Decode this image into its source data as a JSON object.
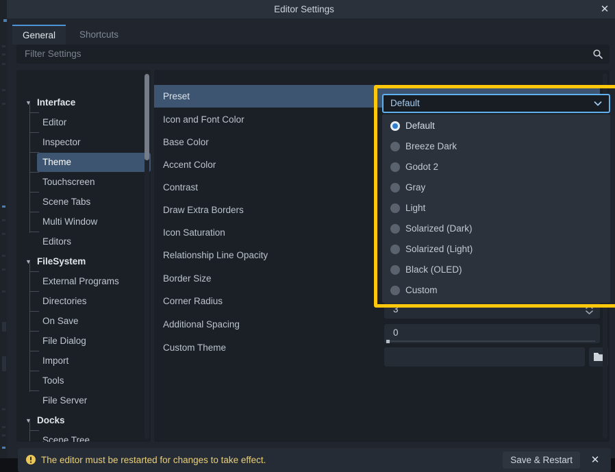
{
  "window": {
    "title": "Editor Settings",
    "close_icon": "close-icon"
  },
  "tabs": [
    {
      "label": "General",
      "active": true
    },
    {
      "label": "Shortcuts",
      "active": false
    }
  ],
  "filter": {
    "placeholder": "Filter Settings",
    "value": "",
    "icon": "search-icon"
  },
  "sidebar": {
    "items": [
      {
        "label": "Interface",
        "type": "category",
        "expanded": true,
        "selected": false
      },
      {
        "label": "Editor",
        "type": "child",
        "selected": false
      },
      {
        "label": "Inspector",
        "type": "child",
        "selected": false
      },
      {
        "label": "Theme",
        "type": "child",
        "selected": true
      },
      {
        "label": "Touchscreen",
        "type": "child",
        "selected": false
      },
      {
        "label": "Scene Tabs",
        "type": "child",
        "selected": false
      },
      {
        "label": "Multi Window",
        "type": "child",
        "selected": false
      },
      {
        "label": "Editors",
        "type": "child",
        "selected": false
      },
      {
        "label": "FileSystem",
        "type": "category",
        "expanded": true,
        "selected": false
      },
      {
        "label": "External Programs",
        "type": "child",
        "selected": false
      },
      {
        "label": "Directories",
        "type": "child",
        "selected": false
      },
      {
        "label": "On Save",
        "type": "child",
        "selected": false
      },
      {
        "label": "File Dialog",
        "type": "child",
        "selected": false
      },
      {
        "label": "Import",
        "type": "child",
        "selected": false
      },
      {
        "label": "Tools",
        "type": "child",
        "selected": false
      },
      {
        "label": "File Server",
        "type": "child",
        "selected": false
      },
      {
        "label": "Docks",
        "type": "category",
        "expanded": true,
        "selected": false
      },
      {
        "label": "Scene Tree",
        "type": "child",
        "selected": false
      }
    ]
  },
  "properties": [
    {
      "name": "Preset",
      "selected": true
    },
    {
      "name": "Icon and Font Color",
      "selected": false
    },
    {
      "name": "Base Color",
      "selected": false
    },
    {
      "name": "Accent Color",
      "selected": false
    },
    {
      "name": "Contrast",
      "selected": false
    },
    {
      "name": "Draw Extra Borders",
      "selected": false
    },
    {
      "name": "Icon Saturation",
      "selected": false
    },
    {
      "name": "Relationship Line Opacity",
      "selected": false
    },
    {
      "name": "Border Size",
      "selected": false
    },
    {
      "name": "Corner Radius",
      "selected": false
    },
    {
      "name": "Additional Spacing",
      "selected": false
    },
    {
      "name": "Custom Theme",
      "selected": false
    }
  ],
  "values": {
    "corner_radius": "3",
    "additional_spacing": "0",
    "custom_theme": "",
    "browse_icon": "folder-icon",
    "spinner_icon": "spinner-arrows-icon"
  },
  "preset_combo": {
    "selected": "Default",
    "chevron_icon": "chevron-down-icon",
    "options": [
      {
        "label": "Default",
        "checked": true
      },
      {
        "label": "Breeze Dark",
        "checked": false
      },
      {
        "label": "Godot 2",
        "checked": false
      },
      {
        "label": "Gray",
        "checked": false
      },
      {
        "label": "Light",
        "checked": false
      },
      {
        "label": "Solarized (Dark)",
        "checked": false
      },
      {
        "label": "Solarized (Light)",
        "checked": false
      },
      {
        "label": "Black (OLED)",
        "checked": false
      },
      {
        "label": "Custom",
        "checked": false
      }
    ]
  },
  "footer": {
    "warning_icon": "warning-icon",
    "message": "The editor must be restarted for changes to take effect.",
    "save_label": "Save & Restart",
    "dismiss_icon": "close-icon"
  },
  "colors": {
    "highlight": "#FFC80A",
    "accent": "#5eb0ef",
    "selection": "#3d5570",
    "warning": "#e9d07a",
    "panel": "#1b2026",
    "window": "#21262e"
  }
}
